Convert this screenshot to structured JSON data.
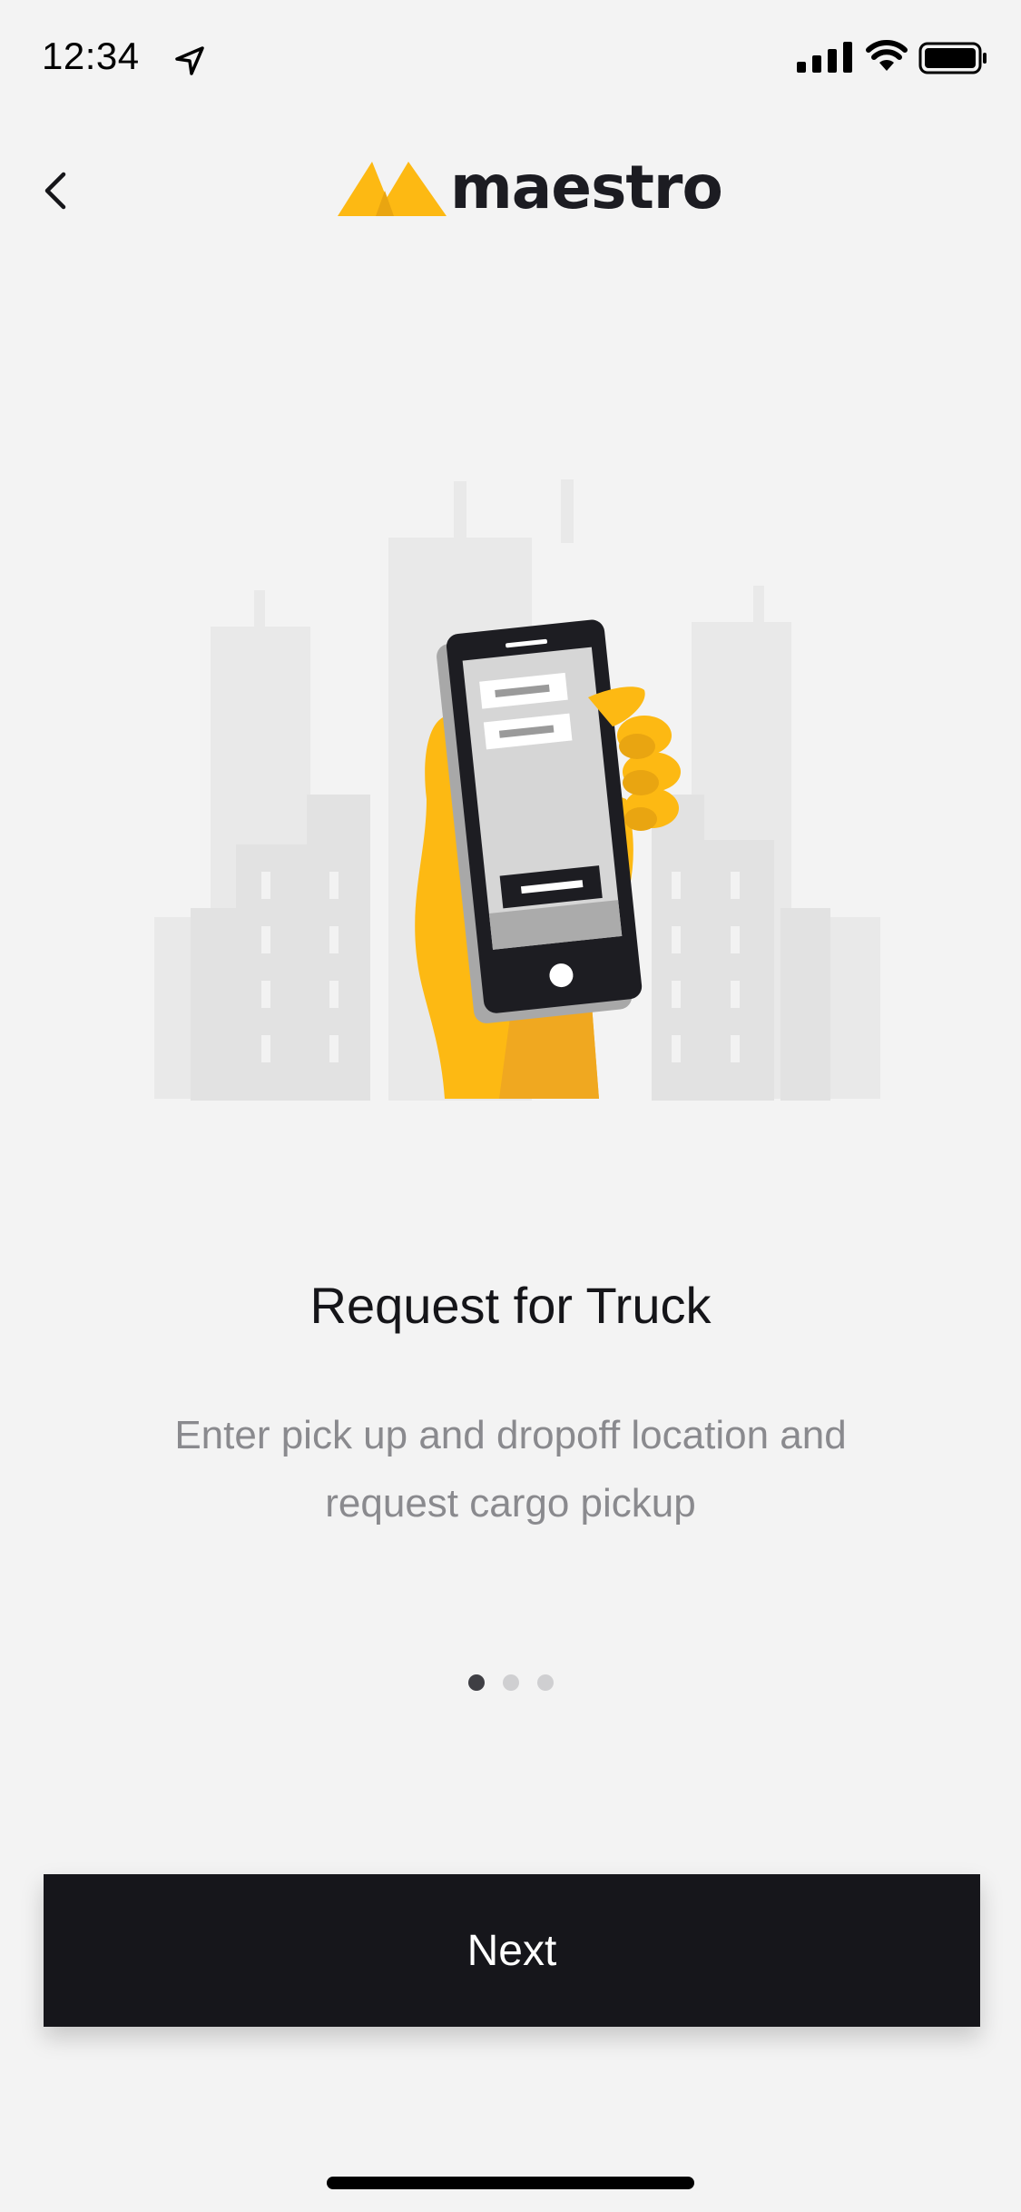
{
  "status_bar": {
    "time": "12:34",
    "icons": [
      "location-arrow-icon",
      "signal-icon",
      "wifi-icon",
      "battery-icon"
    ]
  },
  "nav": {
    "back_icon": "chevron-left-icon",
    "logo_text": "maestro"
  },
  "onboarding": {
    "title": "Request for Truck",
    "description": "Enter pick up and dropoff location and request cargo pickup",
    "page_count": 3,
    "current_page": 1
  },
  "footer": {
    "next_label": "Next"
  },
  "colors": {
    "accent": "#FDB913",
    "accent_dark": "#E9A511",
    "button_bg": "#16161B",
    "background": "#F3F3F3",
    "text_primary": "#151519",
    "text_secondary": "#8A8A8E"
  }
}
